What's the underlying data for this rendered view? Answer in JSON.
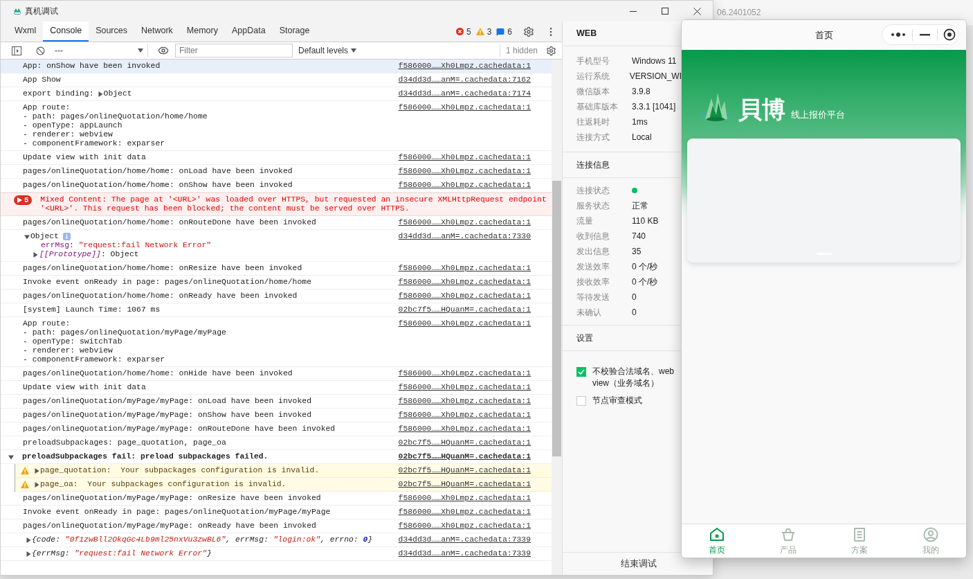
{
  "background_window": {
    "version": "06.2401052"
  },
  "devtools": {
    "title": "真机调试",
    "tabs": [
      {
        "label": "Wxml",
        "selected": false
      },
      {
        "label": "Console",
        "selected": true
      },
      {
        "label": "Sources",
        "selected": false
      },
      {
        "label": "Network",
        "selected": false
      },
      {
        "label": "Memory",
        "selected": false
      },
      {
        "label": "AppData",
        "selected": false
      },
      {
        "label": "Storage",
        "selected": false
      }
    ],
    "counts": {
      "errors": "5",
      "warnings": "3",
      "info": "6"
    },
    "toolbar": {
      "context": "---",
      "filter_placeholder": "Filter",
      "levels": "Default levels",
      "hidden": "1 hidden"
    },
    "messages": [
      {
        "kind": "log",
        "selected": true,
        "lines": [
          "App: onShow have been invoked"
        ],
        "source": "f586000……Xh0Lmpz.cachedata:1"
      },
      {
        "kind": "log",
        "selected": false,
        "lines": [
          "App Show"
        ],
        "source": "d34dd3d……anM=.cachedata:7162"
      },
      {
        "kind": "binding",
        "selected": false,
        "text": "export binding:",
        "object": "Object",
        "expanded": false,
        "source": "d34dd3d……anM=.cachedata:7174"
      },
      {
        "kind": "log",
        "selected": false,
        "lines": [
          "App route:",
          "- path: pages/onlineQuotation/home/home",
          "- openType: appLaunch",
          "- renderer: webview",
          "- componentFramework: exparser"
        ],
        "source": "f586000……Xh0Lmpz.cachedata:1"
      },
      {
        "kind": "log",
        "selected": false,
        "lines": [
          "Update view with init data"
        ],
        "source": "f586000……Xh0Lmpz.cachedata:1"
      },
      {
        "kind": "log",
        "selected": false,
        "lines": [
          "pages/onlineQuotation/home/home: onLoad have been invoked"
        ],
        "source": "f586000……Xh0Lmpz.cachedata:1"
      },
      {
        "kind": "log",
        "selected": false,
        "lines": [
          "pages/onlineQuotation/home/home: onShow have been invoked"
        ],
        "source": "f586000……Xh0Lmpz.cachedata:1"
      },
      {
        "kind": "error",
        "selected": false,
        "count": "5",
        "lines": [
          "Mixed Content: The page at '<URL>' was loaded over HTTPS, but requested an insecure XMLHttpRequest endpoint",
          "'<URL>'. This request has been blocked; the content must be served over HTTPS."
        ]
      },
      {
        "kind": "log",
        "selected": false,
        "lines": [
          "pages/onlineQuotation/home/home: onRouteDone have been invoked"
        ],
        "source": "f586000……Xh0Lmpz.cachedata:1"
      },
      {
        "kind": "object",
        "selected": false,
        "label": "Object",
        "expanded": true,
        "source": "d34dd3d……anM=.cachedata:7330",
        "children": [
          {
            "kind": "property",
            "segments": [
              {
                "text": "errMsg",
                "color": "#881280",
                "italic": false
              },
              {
                "text": ": ",
                "italic": false
              },
              {
                "text": "\"request:fail Network Error\"",
                "color": "#c41a16",
                "italic": false
              }
            ]
          },
          {
            "kind": "node",
            "expanded": false,
            "segments": [
              {
                "text": "[[Prototype]]",
                "color": "#881280",
                "italic": true
              },
              {
                "text": ": Object",
                "italic": false
              }
            ]
          }
        ]
      },
      {
        "kind": "log",
        "selected": false,
        "lines": [
          "pages/onlineQuotation/home/home: onResize have been invoked"
        ],
        "source": "f586000……Xh0Lmpz.cachedata:1"
      },
      {
        "kind": "log",
        "selected": false,
        "lines": [
          "Invoke event onReady in page: pages/onlineQuotation/home/home"
        ],
        "source": "f586000……Xh0Lmpz.cachedata:1"
      },
      {
        "kind": "log",
        "selected": false,
        "lines": [
          "pages/onlineQuotation/home/home: onReady have been invoked"
        ],
        "source": "f586000……Xh0Lmpz.cachedata:1"
      },
      {
        "kind": "log",
        "selected": false,
        "lines": [
          "[system] Launch Time: 1067 ms"
        ],
        "source": "02bc7f5……HQuanM=.cachedata:1"
      },
      {
        "kind": "log",
        "selected": false,
        "lines": [
          "App route:",
          "- path: pages/onlineQuotation/myPage/myPage",
          "- openType: switchTab",
          "- renderer: webview",
          "- componentFramework: exparser"
        ],
        "source": "f586000……Xh0Lmpz.cachedata:1"
      },
      {
        "kind": "log",
        "selected": false,
        "lines": [
          "pages/onlineQuotation/home/home: onHide have been invoked"
        ],
        "source": "f586000……Xh0Lmpz.cachedata:1"
      },
      {
        "kind": "log",
        "selected": false,
        "lines": [
          "Update view with init data"
        ],
        "source": "f586000……Xh0Lmpz.cachedata:1"
      },
      {
        "kind": "log",
        "selected": false,
        "lines": [
          "pages/onlineQuotation/myPage/myPage: onLoad have been invoked"
        ],
        "source": "f586000……Xh0Lmpz.cachedata:1"
      },
      {
        "kind": "log",
        "selected": false,
        "lines": [
          "pages/onlineQuotation/myPage/myPage: onShow have been invoked"
        ],
        "source": "f586000……Xh0Lmpz.cachedata:1"
      },
      {
        "kind": "log",
        "selected": false,
        "lines": [
          "pages/onlineQuotation/myPage/myPage: onRouteDone have been invoked"
        ],
        "source": "f586000……Xh0Lmpz.cachedata:1"
      },
      {
        "kind": "log",
        "selected": false,
        "lines": [
          "preloadSubpackages: page_quotation, page_oa"
        ],
        "source": "02bc7f5……HQuanM=.cachedata:1"
      },
      {
        "kind": "group",
        "selected": false,
        "text": "preloadSubpackages fail: preload subpackages failed.",
        "expanded": true,
        "source": "02bc7f5……HQuanM=.cachedata:1",
        "children": [
          {
            "kind": "warning",
            "selected": false,
            "expanded": false,
            "text": "page_quotation:  Your subpackages configuration is invalid.",
            "source": "02bc7f5……HQuanM=.cachedata:1"
          },
          {
            "kind": "warning",
            "selected": false,
            "expanded": false,
            "text": "page_oa:  Your subpackages configuration is invalid.",
            "source": "02bc7f5……HQuanM=.cachedata:1"
          }
        ]
      },
      {
        "kind": "log",
        "selected": false,
        "lines": [
          "pages/onlineQuotation/myPage/myPage: onResize have been invoked"
        ],
        "source": "f586000……Xh0Lmpz.cachedata:1"
      },
      {
        "kind": "log",
        "selected": false,
        "lines": [
          "Invoke event onReady in page: pages/onlineQuotation/myPage/myPage"
        ],
        "source": "f586000……Xh0Lmpz.cachedata:1"
      },
      {
        "kind": "log",
        "selected": false,
        "lines": [
          "pages/onlineQuotation/myPage/myPage: onReady have been invoked"
        ],
        "source": "f586000……Xh0Lmpz.cachedata:1"
      },
      {
        "kind": "inline_object",
        "selected": false,
        "expanded": false,
        "source": "d34dd3d……anM=.cachedata:7339",
        "segments": [
          {
            "text": "{code: "
          },
          {
            "text": "\"0f1zwBll2OkqGc4Lb9ml25nxVu3zwBL6\"",
            "color": "#c41a16"
          },
          {
            "text": ", errMsg: "
          },
          {
            "text": "\"login:ok\"",
            "color": "#c41a16"
          },
          {
            "text": ", errno: "
          },
          {
            "text": "0",
            "color": "#1a1aa6"
          },
          {
            "text": "}"
          }
        ]
      },
      {
        "kind": "inline_object",
        "selected": false,
        "expanded": false,
        "source": "d34dd3d……anM=.cachedata:7339",
        "segments": [
          {
            "text": "{errMsg: "
          },
          {
            "text": "\"request:fail Network Error\"",
            "color": "#c41a16"
          },
          {
            "text": "}"
          }
        ]
      }
    ],
    "panel": {
      "title": "WEB",
      "info": [
        {
          "label": "手机型号",
          "value": "Windows 11"
        },
        {
          "label": "运行系统",
          "value": "VERSION_WI"
        },
        {
          "label": "微信版本",
          "value": "3.9.8"
        },
        {
          "label": "基础库版本",
          "value": "3.3.1 [1041]"
        },
        {
          "label": "往返耗时",
          "value": "1ms"
        },
        {
          "label": "连接方式",
          "value": "Local"
        }
      ],
      "connection_title": "连接信息",
      "connection": [
        {
          "kind": "status",
          "label": "连接状态",
          "on": true
        },
        {
          "kind": "text",
          "label": "服务状态",
          "value": "正常"
        },
        {
          "kind": "text",
          "label": "流量",
          "value": "110 KB"
        },
        {
          "kind": "text",
          "label": "收到信息",
          "value": "740"
        },
        {
          "kind": "text",
          "label": "发出信息",
          "value": "35"
        },
        {
          "kind": "text",
          "label": "发送效率",
          "value": "0 个/秒"
        },
        {
          "kind": "text",
          "label": "接收效率",
          "value": "0 个/秒"
        },
        {
          "kind": "text",
          "label": "等待发送",
          "value": "0"
        },
        {
          "kind": "text",
          "label": "未确认",
          "value": "0"
        }
      ],
      "settings_title": "设置",
      "settings": [
        {
          "label": "不校验合法域名、web view（业务域名）",
          "checked": true
        },
        {
          "label": "节点审查模式",
          "checked": false
        }
      ],
      "end_button": "结束调试"
    }
  },
  "phone": {
    "title": "首页",
    "brand": "貝博",
    "tagline": "线上报价平台",
    "tabs": [
      {
        "kind": "home",
        "label": "首页",
        "selected": true
      },
      {
        "kind": "product",
        "label": "产品",
        "selected": false
      },
      {
        "kind": "plan",
        "label": "方案",
        "selected": false
      },
      {
        "kind": "profile",
        "label": "我的",
        "selected": false
      }
    ]
  }
}
